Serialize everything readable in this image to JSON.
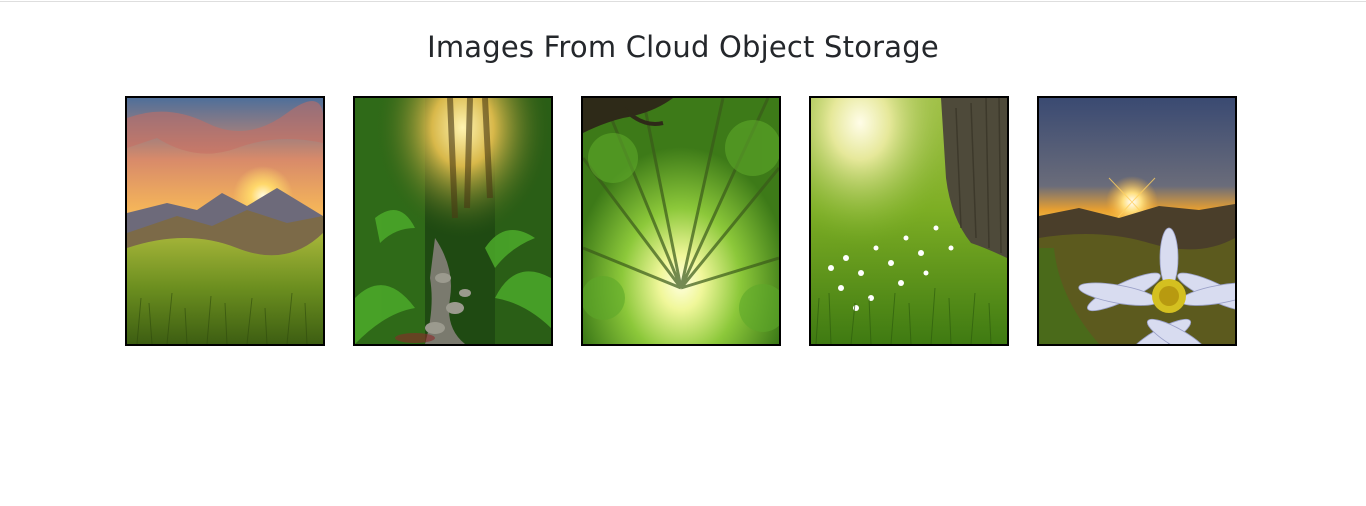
{
  "page": {
    "title": "Images From Cloud Object Storage"
  },
  "gallery": {
    "images": [
      {
        "subject": "mountain-sunset-meadow"
      },
      {
        "subject": "jungle-stream"
      },
      {
        "subject": "forest-canopy-sunlight"
      },
      {
        "subject": "meadow-tree-flowers"
      },
      {
        "subject": "daisy-mountain-sunrise"
      }
    ]
  }
}
